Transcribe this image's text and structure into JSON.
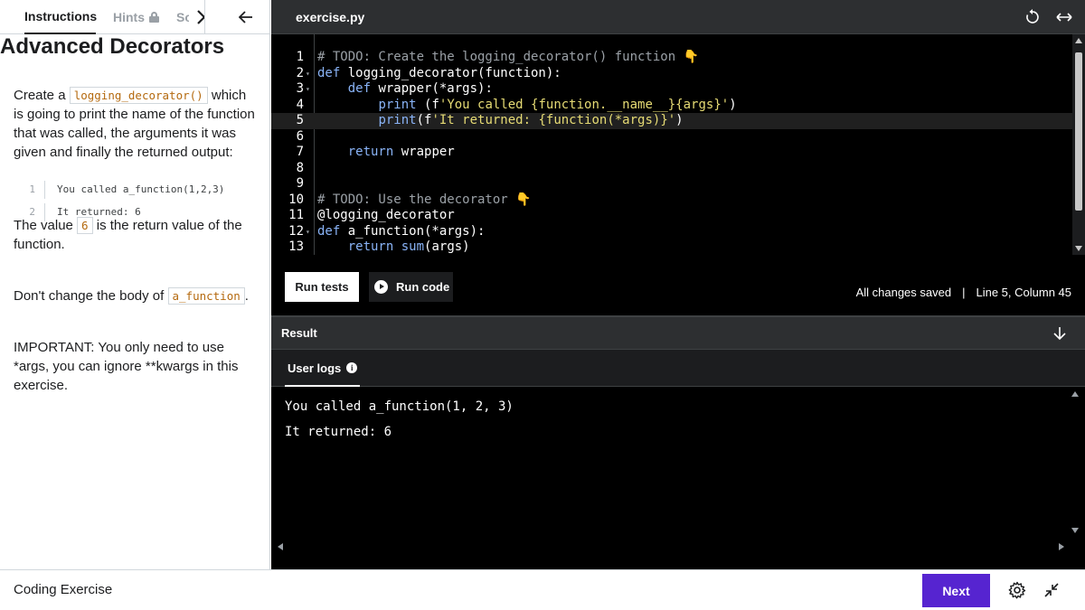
{
  "left": {
    "tabs": {
      "instructions": "Instructions",
      "hints": "Hints",
      "solution": "So"
    },
    "heading": "Advanced Decorators",
    "p1_before": "Create a ",
    "p1_code": "logging_decorator()",
    "p1_after": " which is going to print the name of the function that was called, the arguments it was given and finally the returned output:",
    "example": [
      {
        "num": "1",
        "text": "You called a_function(1,2,3)"
      },
      {
        "num": "2",
        "text": "It returned: 6"
      }
    ],
    "p2_before": "The value ",
    "p2_code": "6",
    "p2_after": " is the return value of the function.",
    "p3_before": "Don't change the body of ",
    "p3_code": "a_function",
    "p3_after": ".",
    "p4": "IMPORTANT: You only need to use *args, you can ignore **kwargs in this exercise."
  },
  "editor": {
    "filename": "exercise.py",
    "active_line": 5,
    "lines": [
      {
        "num": "1",
        "fold": false,
        "segments": [
          {
            "cls": "c-comment",
            "t": "# TODO: Create the logging_decorator() function 👇"
          }
        ]
      },
      {
        "num": "2",
        "fold": true,
        "segments": [
          {
            "cls": "c-kw",
            "t": "def "
          },
          {
            "cls": "c-fn",
            "t": "logging_decorator(function):"
          }
        ]
      },
      {
        "num": "3",
        "fold": true,
        "segments": [
          {
            "cls": "c-plain",
            "t": "    "
          },
          {
            "cls": "c-kw",
            "t": "def "
          },
          {
            "cls": "c-fn",
            "t": "wrapper(*args):"
          }
        ]
      },
      {
        "num": "4",
        "fold": false,
        "segments": [
          {
            "cls": "c-plain",
            "t": "        "
          },
          {
            "cls": "c-builtin",
            "t": "print"
          },
          {
            "cls": "c-plain",
            "t": " (f"
          },
          {
            "cls": "c-str",
            "t": "'You called {function.__name__}{args}'"
          },
          {
            "cls": "c-plain",
            "t": ")"
          }
        ]
      },
      {
        "num": "5",
        "fold": false,
        "segments": [
          {
            "cls": "c-plain",
            "t": "        "
          },
          {
            "cls": "c-builtin",
            "t": "print"
          },
          {
            "cls": "c-plain",
            "t": "(f"
          },
          {
            "cls": "c-str",
            "t": "'It returned: {function(*args)}'"
          },
          {
            "cls": "c-plain",
            "t": ")"
          }
        ]
      },
      {
        "num": "6",
        "fold": false,
        "segments": []
      },
      {
        "num": "7",
        "fold": false,
        "segments": [
          {
            "cls": "c-plain",
            "t": "    "
          },
          {
            "cls": "c-kw",
            "t": "return "
          },
          {
            "cls": "c-plain",
            "t": "wrapper"
          }
        ]
      },
      {
        "num": "8",
        "fold": false,
        "segments": []
      },
      {
        "num": "9",
        "fold": false,
        "segments": []
      },
      {
        "num": "10",
        "fold": false,
        "segments": [
          {
            "cls": "c-comment",
            "t": "# TODO: Use the decorator 👇"
          }
        ]
      },
      {
        "num": "11",
        "fold": false,
        "segments": [
          {
            "cls": "c-plain",
            "t": "@logging_decorator"
          }
        ]
      },
      {
        "num": "12",
        "fold": true,
        "segments": [
          {
            "cls": "c-kw",
            "t": "def "
          },
          {
            "cls": "c-fn",
            "t": "a_function(*args):"
          }
        ]
      },
      {
        "num": "13",
        "fold": false,
        "segments": [
          {
            "cls": "c-plain",
            "t": "    "
          },
          {
            "cls": "c-kw",
            "t": "return "
          },
          {
            "cls": "c-builtin",
            "t": "sum"
          },
          {
            "cls": "c-plain",
            "t": "(args)"
          }
        ]
      }
    ]
  },
  "actions": {
    "run_tests": "Run tests",
    "run_code": "Run code",
    "saved": "All changes saved",
    "separator": "|",
    "position": "Line 5, Column 45"
  },
  "result": {
    "title": "Result",
    "logs_tab": "User logs",
    "info": "i",
    "output": [
      "You called a_function(1, 2, 3)",
      "It returned: 6"
    ]
  },
  "footer": {
    "label": "Coding Exercise",
    "next": "Next"
  }
}
